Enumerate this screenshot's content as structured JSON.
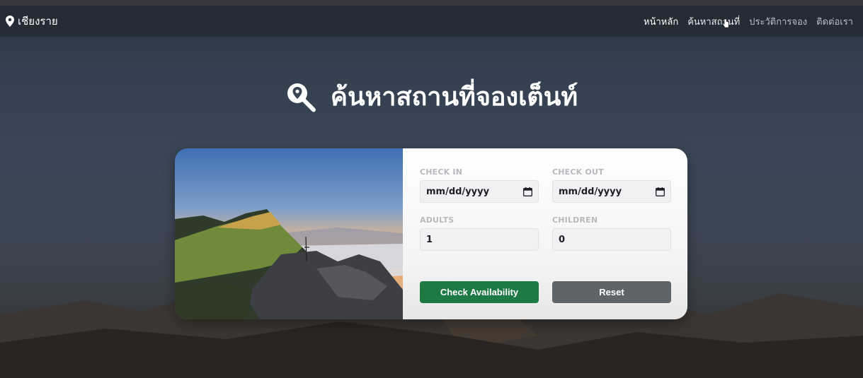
{
  "navbar": {
    "brand": "เชียงราย",
    "brand_icon": "map-pin-icon",
    "links": [
      {
        "label": "หน้าหลัก",
        "active": true
      },
      {
        "label": "ค้นหาสถานที่",
        "active": false
      },
      {
        "label": "ประวัติการจอง",
        "active": false
      },
      {
        "label": "ติดต่อเรา",
        "active": false
      }
    ]
  },
  "hero": {
    "title": "ค้นหาสถานที่จองเต็นท์",
    "icon": "search-location-icon"
  },
  "form": {
    "check_in": {
      "label": "CHECK IN",
      "value": "mm/dd/yyyy"
    },
    "check_out": {
      "label": "CHECK OUT",
      "value": "mm/dd/yyyy"
    },
    "adults": {
      "label": "ADULTS",
      "value": "1"
    },
    "children": {
      "label": "CHILDREN",
      "value": "0"
    },
    "check_button": "Check Availability",
    "reset_button": "Reset"
  },
  "colors": {
    "primary_button": "#1d7a45",
    "secondary_button": "#5f6468"
  }
}
